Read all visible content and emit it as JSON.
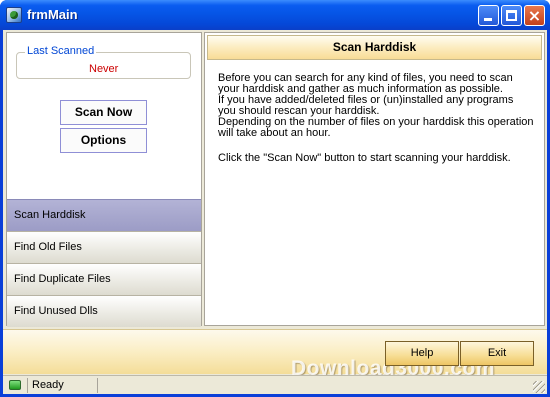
{
  "window": {
    "title": "frmMain",
    "icon": "app-icon",
    "controls": {
      "minimize": "minimize-icon",
      "maximize": "maximize-icon",
      "close": "close-icon",
      "close_glyph": "×"
    }
  },
  "sidebar": {
    "last_scanned_label": "Last Scanned",
    "last_scanned_value": "Never",
    "buttons": {
      "scan_now": "Scan Now",
      "options": "Options"
    },
    "nav_items": [
      {
        "label": "Scan Harddisk",
        "active": true
      },
      {
        "label": "Find Old Files",
        "active": false
      },
      {
        "label": "Find Duplicate Files",
        "active": false
      },
      {
        "label": "Find Unused Dlls",
        "active": false
      }
    ]
  },
  "content": {
    "title": "Scan Harddisk",
    "lines": [
      "Before you can search for any kind of files, you need to scan",
      "your harddisk and gather as much information as possible.",
      "If you have added/deleted files or (un)installed any programs",
      "you should rescan your harddisk.",
      "Depending on the number of files on your harddisk this operation",
      "will take about an hour.",
      "Click the \"Scan Now\" button to start scanning your harddisk."
    ]
  },
  "footer": {
    "help_label": "Help",
    "exit_label": "Exit",
    "watermark": "Download3000.com"
  },
  "statusbar": {
    "text": "Ready",
    "indicator_color": "#2fa82f"
  },
  "colors": {
    "title_bar": "#0655e6",
    "active_nav": "#a5a5cc",
    "header_bg": "#fcecc0",
    "last_scanned_label": "#0046d5",
    "never_text": "#cc0000"
  }
}
